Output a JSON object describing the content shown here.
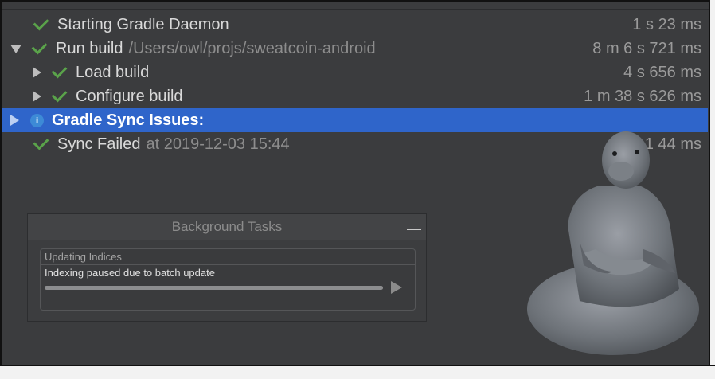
{
  "build_rows": [
    {
      "label": "Starting Gradle Daemon",
      "path": "",
      "time": "1 s 23 ms"
    },
    {
      "label": "Run build",
      "path": "/Users/owl/projs/sweatcoin-android",
      "time": "8 m 6 s 721 ms"
    },
    {
      "label": "Load build",
      "path": "",
      "time": "4 s 656 ms"
    },
    {
      "label": "Configure build",
      "path": "",
      "time": "1 m 38 s 626 ms"
    },
    {
      "label": "Gradle Sync Issues:",
      "path": "",
      "time": ""
    },
    {
      "label": "Sync Failed",
      "path": "at 2019-12-03 15:44",
      "time": "8 m 1  44 ms"
    }
  ],
  "background_tasks": {
    "title": "Background Tasks",
    "minimize_symbol": "—",
    "task": {
      "title": "Updating Indices",
      "text": "Indexing paused due to batch update",
      "progress": 1.0
    }
  },
  "colors": {
    "selection": "#2f65ca",
    "check": "#5aa34a",
    "info": "#3d8ad6"
  }
}
